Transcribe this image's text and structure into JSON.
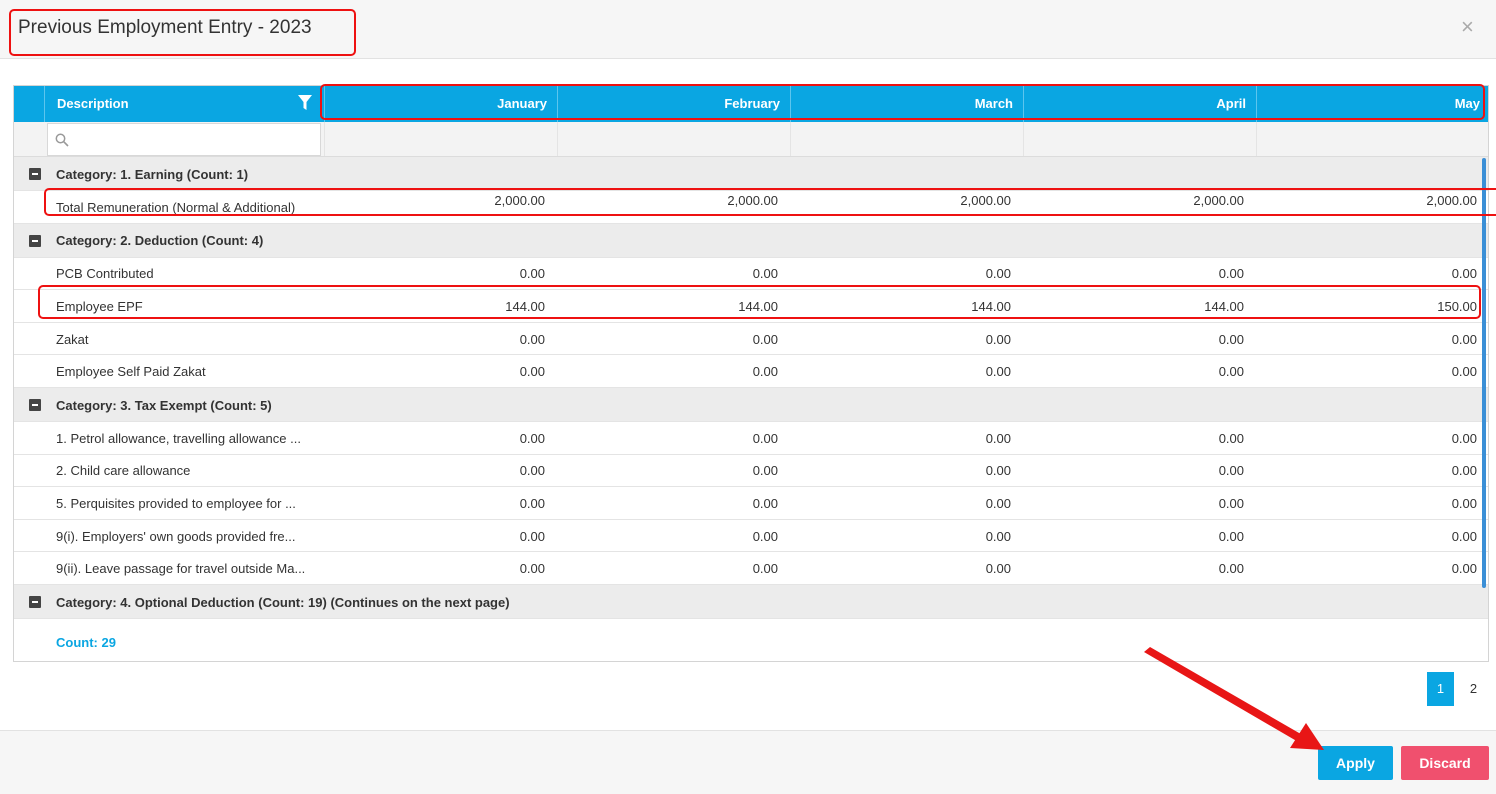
{
  "dialog": {
    "title": "Previous Employment Entry - 2023",
    "close_glyph": "×"
  },
  "grid": {
    "columns": [
      "Description",
      "January",
      "February",
      "March",
      "April",
      "May"
    ],
    "filter_placeholder": "",
    "rows": [
      {
        "type": "category",
        "label": "Category: 1. Earning (Count: 1)"
      },
      {
        "type": "item",
        "label": "Total Remuneration (Normal & Additional)",
        "values": [
          "2,000.00",
          "2,000.00",
          "2,000.00",
          "2,000.00",
          "2,000.00"
        ]
      },
      {
        "type": "category",
        "label": "Category: 2. Deduction (Count: 4)"
      },
      {
        "type": "item",
        "label": "PCB Contributed",
        "values": [
          "0.00",
          "0.00",
          "0.00",
          "0.00",
          "0.00"
        ]
      },
      {
        "type": "item",
        "label": "Employee EPF",
        "values": [
          "144.00",
          "144.00",
          "144.00",
          "144.00",
          "150.00"
        ]
      },
      {
        "type": "item",
        "label": "Zakat",
        "values": [
          "0.00",
          "0.00",
          "0.00",
          "0.00",
          "0.00"
        ]
      },
      {
        "type": "item",
        "label": "Employee Self Paid Zakat",
        "values": [
          "0.00",
          "0.00",
          "0.00",
          "0.00",
          "0.00"
        ]
      },
      {
        "type": "category",
        "label": "Category: 3. Tax Exempt (Count: 5)"
      },
      {
        "type": "item",
        "label": "1. Petrol allowance, travelling allowance ...",
        "values": [
          "0.00",
          "0.00",
          "0.00",
          "0.00",
          "0.00"
        ]
      },
      {
        "type": "item",
        "label": "2. Child care allowance",
        "values": [
          "0.00",
          "0.00",
          "0.00",
          "0.00",
          "0.00"
        ]
      },
      {
        "type": "item",
        "label": "5. Perquisites provided to employee for ...",
        "values": [
          "0.00",
          "0.00",
          "0.00",
          "0.00",
          "0.00"
        ]
      },
      {
        "type": "item",
        "label": "9(i). Employers' own goods provided fre...",
        "values": [
          "0.00",
          "0.00",
          "0.00",
          "0.00",
          "0.00"
        ]
      },
      {
        "type": "item",
        "label": "9(ii). Leave passage for travel outside Ma...",
        "values": [
          "0.00",
          "0.00",
          "0.00",
          "0.00",
          "0.00"
        ]
      },
      {
        "type": "category",
        "label": "Category: 4. Optional Deduction (Count: 19) (Continues on the next page)"
      }
    ],
    "total_count": "Count: 29"
  },
  "pagination": {
    "pages": [
      "1",
      "2"
    ],
    "current": "1"
  },
  "footer": {
    "apply_label": "Apply",
    "discard_label": "Discard"
  },
  "colors": {
    "accent": "#0aa6e2",
    "discard": "#f0506e",
    "highlight": "#e11111"
  }
}
